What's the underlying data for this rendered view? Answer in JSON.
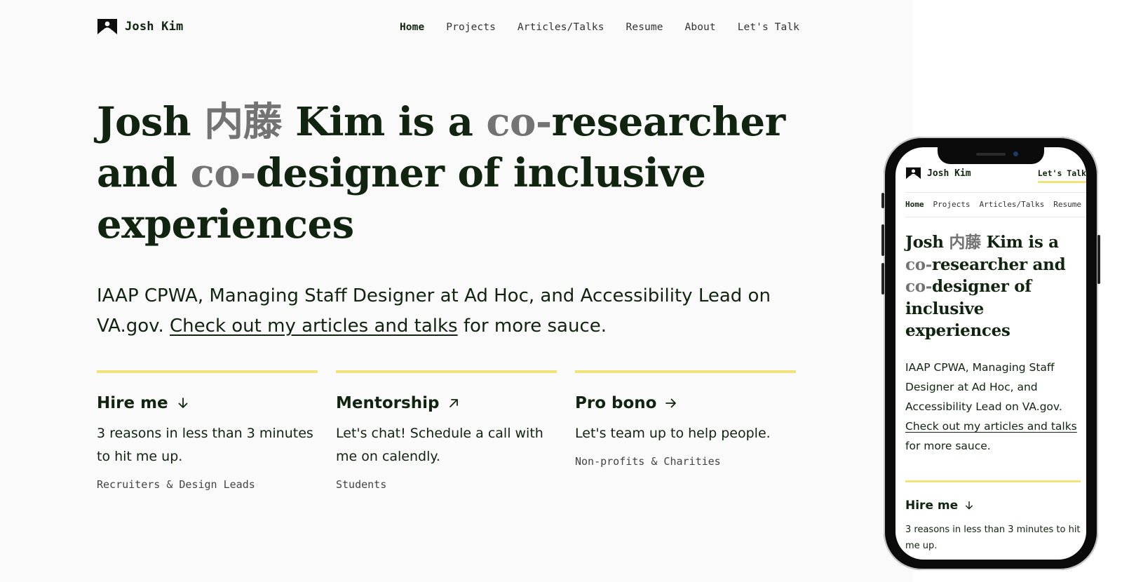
{
  "site": {
    "name": "Josh Kim",
    "logo_icon": "speech-bubble-person-icon"
  },
  "nav": {
    "items": [
      {
        "label": "Home",
        "active": true
      },
      {
        "label": "Projects"
      },
      {
        "label": "Articles/Talks"
      },
      {
        "label": "Resume"
      },
      {
        "label": "About"
      },
      {
        "label": "Let's Talk"
      }
    ]
  },
  "hero": {
    "part1": "Josh ",
    "cjk": "内藤",
    "part2": " Kim is a ",
    "co1": "co-",
    "part3": "researcher and ",
    "co2": "co-",
    "part4": "designer of inclusive experiences"
  },
  "intro": {
    "lead": "IAAP CPWA, Managing Staff Designer at Ad Hoc, and Accessibility Lead on VA.gov. ",
    "link": "Check out my articles and talks",
    "trail": " for more sauce."
  },
  "cards": [
    {
      "title": "Hire me",
      "icon": "arrow-down-icon",
      "desc": "3 reasons in less than 3 minutes to hit me up.",
      "tag": "Recruiters & Design Leads"
    },
    {
      "title": "Mentorship",
      "icon": "arrow-up-right-icon",
      "desc": "Let's chat! Schedule a call with me on calendly.",
      "tag": "Students"
    },
    {
      "title": "Pro bono",
      "icon": "arrow-right-icon",
      "desc": "Let's team up to help people.",
      "tag": "Non-profits & Charities"
    }
  ],
  "mobile": {
    "talk_label": "Let's Talk",
    "nav": [
      "Home",
      "Projects",
      "Articles/Talks",
      "Resume"
    ]
  },
  "colors": {
    "text": "#10240f",
    "muted": "#737373",
    "accent_rule": "#f1e37a",
    "background": "#fafafa"
  }
}
